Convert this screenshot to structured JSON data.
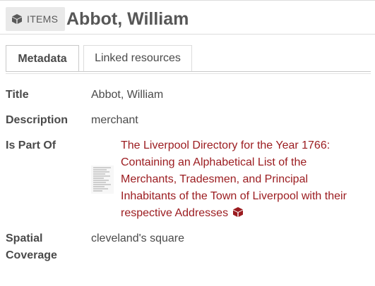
{
  "header": {
    "badge_label": "ITEMS",
    "badge_icon": "cube-icon",
    "title": "Abbot, William"
  },
  "tabs": [
    {
      "label": "Metadata",
      "active": true
    },
    {
      "label": "Linked resources",
      "active": false
    }
  ],
  "fields": {
    "title": {
      "label": "Title",
      "value": "Abbot, William"
    },
    "description": {
      "label": "Description",
      "value": "merchant"
    },
    "is_part_of": {
      "label": "Is Part Of",
      "thumbnail_icon": "document-thumbnail-icon",
      "lines": [
        "The Liverpool Directory for the Year 1766:",
        "Containing an Alphabetical List of the",
        "Merchants, Tradesmen, and Principal",
        "Inhabitants of the Town of Liverpool with their",
        "respective Addresses"
      ],
      "link_icon": "cube-icon"
    },
    "spatial_coverage": {
      "label_line1": "Spatial",
      "label_line2": "Coverage",
      "value": "cleveland's square"
    }
  },
  "colors": {
    "link": "#9b1b1f",
    "badge_bg": "#e9e9e9",
    "text": "#4a4a4a"
  }
}
